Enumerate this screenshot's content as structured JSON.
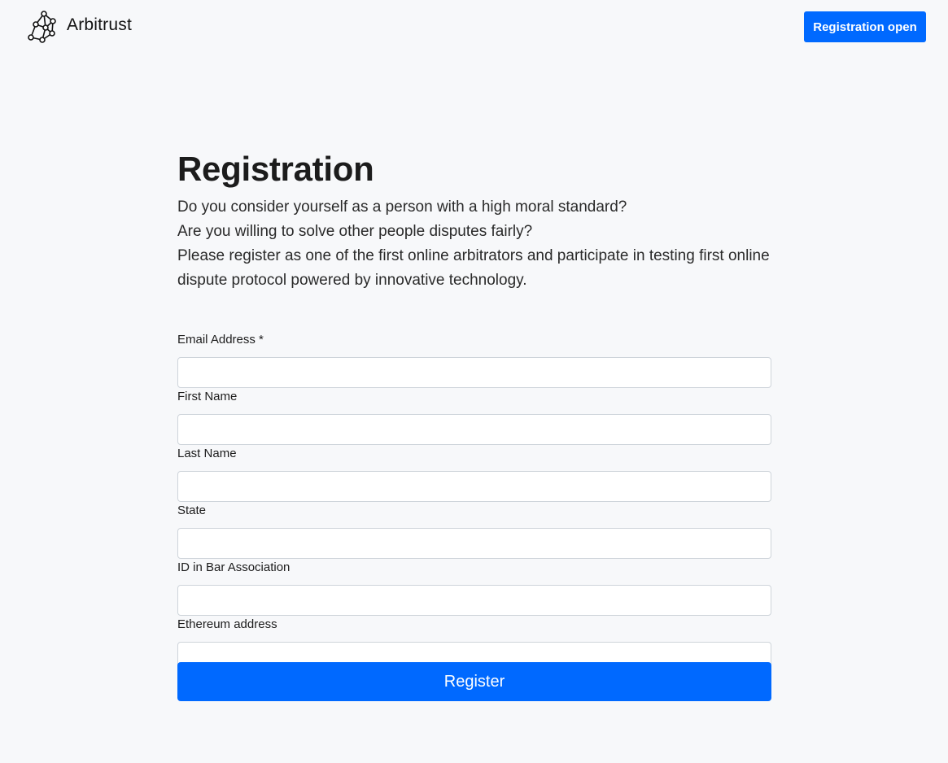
{
  "header": {
    "brand_name": "Arbitrust",
    "logo_icon": "network-graph-icon",
    "registration_open_label": "Registration open"
  },
  "main": {
    "title": "Registration",
    "intro": [
      "Do you consider yourself as a person with a high moral standard?",
      "Are you willing to solve other people disputes fairly?",
      "Please register as one of the first online arbitrators and participate in testing first online dispute protocol powered by innovative technology."
    ]
  },
  "form": {
    "fields": [
      {
        "label": "Email Address *",
        "value": "",
        "placeholder": ""
      },
      {
        "label": "First Name",
        "value": "",
        "placeholder": ""
      },
      {
        "label": "Last Name",
        "value": "",
        "placeholder": ""
      },
      {
        "label": "State",
        "value": "",
        "placeholder": ""
      },
      {
        "label": "ID in Bar Association",
        "value": "",
        "placeholder": ""
      },
      {
        "label": "Ethereum address",
        "value": "",
        "placeholder": ""
      }
    ],
    "submit_label": "Register"
  },
  "colors": {
    "accent": "#0069ff",
    "background": "#f7f8fa",
    "input_border": "#ced4da"
  }
}
